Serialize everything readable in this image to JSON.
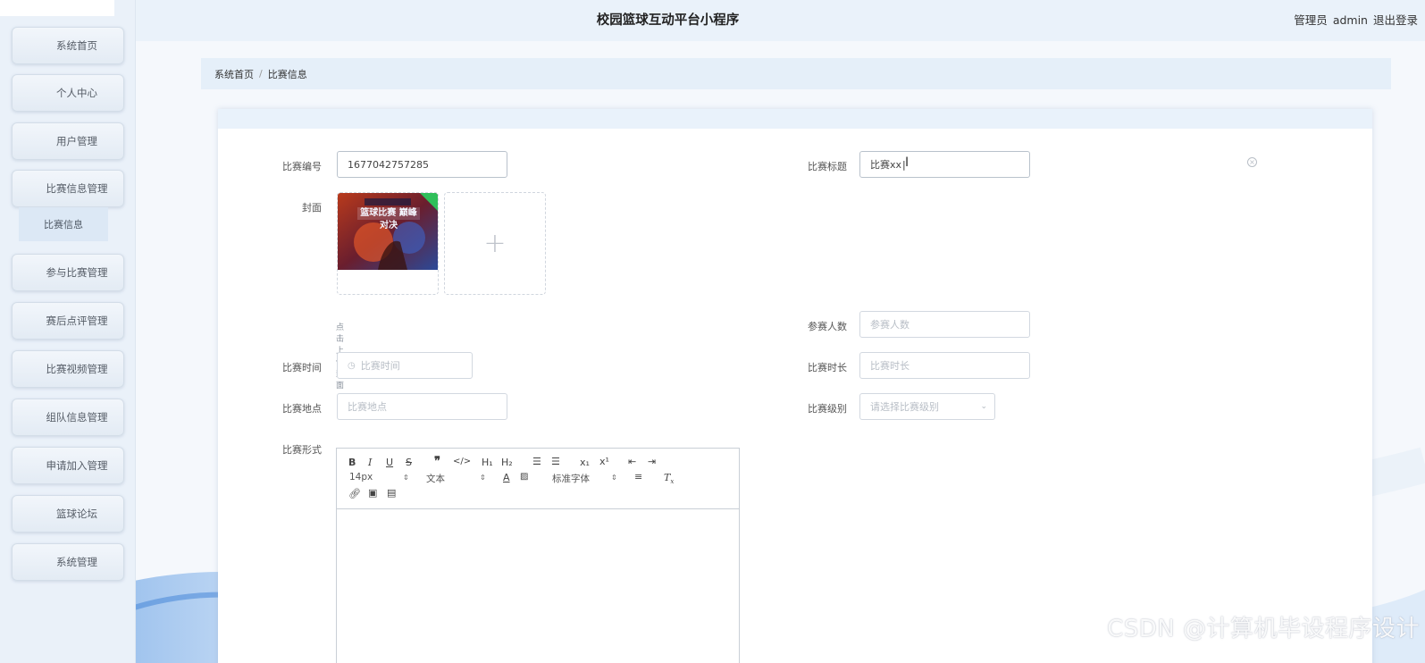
{
  "app": {
    "title": "校园篮球互动平台小程序"
  },
  "header": {
    "role": "管理员",
    "username": "admin",
    "logout": "退出登录"
  },
  "sidebar": {
    "items": [
      {
        "label": "系统首页"
      },
      {
        "label": "个人中心"
      },
      {
        "label": "用户管理"
      },
      {
        "label": "比赛信息管理"
      },
      {
        "label": "参与比赛管理"
      },
      {
        "label": "赛后点评管理"
      },
      {
        "label": "比赛视频管理"
      },
      {
        "label": "组队信息管理"
      },
      {
        "label": "申请加入管理"
      },
      {
        "label": "篮球论坛"
      },
      {
        "label": "系统管理"
      }
    ],
    "submenu": {
      "label": "比赛信息"
    }
  },
  "breadcrumb": {
    "home": "系统首页",
    "current": "比赛信息"
  },
  "form": {
    "match_no": {
      "label": "比赛编号",
      "value": "1677042757285"
    },
    "match_title": {
      "label": "比赛标题",
      "value": "比赛xx"
    },
    "cover": {
      "label": "封面",
      "hint": "点击上传封面",
      "image_text": "篮球比赛 巅峰对决"
    },
    "participants": {
      "label": "参赛人数",
      "placeholder": "参赛人数"
    },
    "match_time": {
      "label": "比赛时间",
      "placeholder": "比赛时间"
    },
    "duration": {
      "label": "比赛时长",
      "placeholder": "比赛时长"
    },
    "location": {
      "label": "比赛地点",
      "placeholder": "比赛地点"
    },
    "level": {
      "label": "比赛级别",
      "placeholder": "请选择比赛级别"
    },
    "format": {
      "label": "比赛形式"
    }
  },
  "editor": {
    "font_size": "14px",
    "paragraph": "文本",
    "font_family": "标准字体"
  },
  "watermark": "CSDN @计算机毕设程序设计"
}
